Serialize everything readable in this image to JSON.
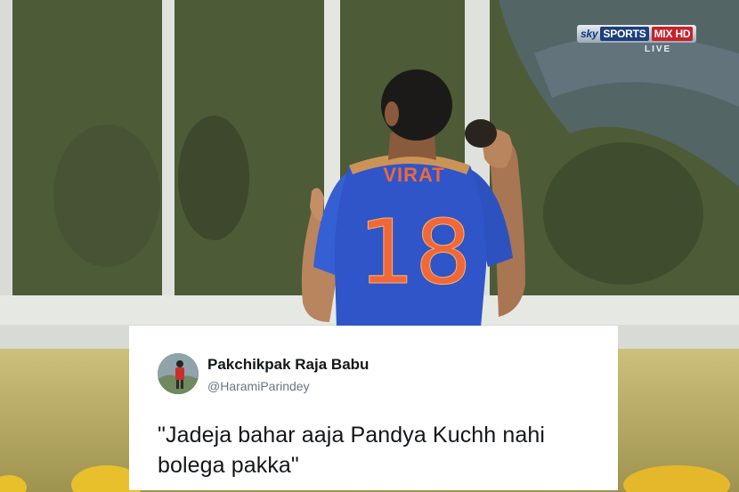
{
  "broadcast": {
    "brand": "sky",
    "channel": "SPORTS",
    "variant": "MIX HD",
    "status": "LIVE"
  },
  "jersey": {
    "name": "VIRAT",
    "number": "18"
  },
  "tweet": {
    "display_name": "Pakchikpak Raja Babu",
    "handle": "@HaramiParindey",
    "text": "\"Jadeja bahar aaja Pandya Kuchh nahi bolega pakka\""
  },
  "colors": {
    "card_background": "#ffffff",
    "name_color": "#14171a",
    "handle_color": "#657786",
    "jersey_blue": "#2f55c8",
    "jersey_number": "#f0683a"
  },
  "icons": {
    "avatar": "person-photo-avatar"
  }
}
